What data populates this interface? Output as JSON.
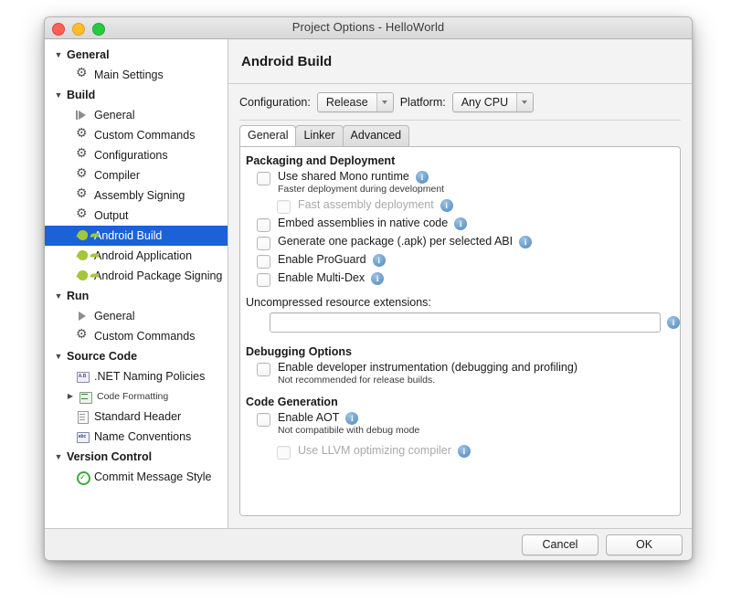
{
  "window": {
    "title": "Project Options - HelloWorld",
    "traffic_lights": [
      "close-red",
      "minimize-yellow",
      "zoom-green"
    ]
  },
  "sidebar": {
    "items": [
      {
        "label": "General",
        "type": "group",
        "icon": "disclosure-down",
        "expanded": true
      },
      {
        "label": "Main Settings",
        "type": "leaf",
        "icon": "gear-icon"
      },
      {
        "label": "Build",
        "type": "group",
        "icon": "disclosure-down",
        "expanded": true
      },
      {
        "label": "General",
        "type": "leaf",
        "icon": "run-icon"
      },
      {
        "label": "Custom Commands",
        "type": "leaf",
        "icon": "gear-icon"
      },
      {
        "label": "Configurations",
        "type": "leaf",
        "icon": "gear-icon"
      },
      {
        "label": "Compiler",
        "type": "leaf",
        "icon": "gear-icon"
      },
      {
        "label": "Assembly Signing",
        "type": "leaf",
        "icon": "gear-icon"
      },
      {
        "label": "Output",
        "type": "leaf",
        "icon": "gear-icon"
      },
      {
        "label": "Android Build",
        "type": "leaf",
        "icon": "android-icon",
        "selected": true
      },
      {
        "label": "Android Application",
        "type": "leaf",
        "icon": "android-icon"
      },
      {
        "label": "Android Package Signing",
        "type": "leaf",
        "icon": "android-icon"
      },
      {
        "label": "Run",
        "type": "group",
        "icon": "disclosure-down",
        "expanded": true
      },
      {
        "label": "General",
        "type": "leaf",
        "icon": "play-icon"
      },
      {
        "label": "Custom Commands",
        "type": "leaf",
        "icon": "gear-icon"
      },
      {
        "label": "Source Code",
        "type": "group",
        "icon": "disclosure-down",
        "expanded": true
      },
      {
        "label": ".NET Naming Policies",
        "type": "leaf",
        "icon": "ab-icon"
      },
      {
        "label": "Code Formatting",
        "type": "leaf-collapsible",
        "icon": "format-icon",
        "expanded": false
      },
      {
        "label": "Standard Header",
        "type": "leaf",
        "icon": "document-icon"
      },
      {
        "label": "Name Conventions",
        "type": "leaf",
        "icon": "name-conventions-icon"
      },
      {
        "label": "Version Control",
        "type": "group",
        "icon": "disclosure-down",
        "expanded": true
      },
      {
        "label": "Commit Message Style",
        "type": "leaf",
        "icon": "check-circle-icon"
      }
    ]
  },
  "pane": {
    "title": "Android Build",
    "configuration_label": "Configuration:",
    "configuration_value": "Release",
    "platform_label": "Platform:",
    "platform_value": "Any CPU",
    "tabs": [
      {
        "label": "General",
        "active": true
      },
      {
        "label": "Linker",
        "active": false
      },
      {
        "label": "Advanced",
        "active": false
      }
    ],
    "sections": {
      "packaging": {
        "heading": "Packaging and Deployment",
        "options": [
          {
            "label": "Use shared Mono runtime",
            "sublabel": "Faster deployment during development",
            "checked": false,
            "disabled": false,
            "info": true,
            "indent": false
          },
          {
            "label": "Fast assembly deployment",
            "sublabel": "",
            "checked": false,
            "disabled": true,
            "info": true,
            "indent": true
          },
          {
            "label": "Embed assemblies in native code",
            "sublabel": "",
            "checked": false,
            "disabled": false,
            "info": true,
            "indent": false
          },
          {
            "label": "Generate one package (.apk) per selected ABI",
            "sublabel": "",
            "checked": false,
            "disabled": false,
            "info": true,
            "indent": false
          },
          {
            "label": "Enable ProGuard",
            "sublabel": "",
            "checked": false,
            "disabled": false,
            "info": true,
            "indent": false
          },
          {
            "label": "Enable Multi-Dex",
            "sublabel": "",
            "checked": false,
            "disabled": false,
            "info": true,
            "indent": false
          }
        ],
        "field_label": "Uncompressed resource extensions:",
        "field_value": "",
        "field_placeholder": ""
      },
      "debugging": {
        "heading": "Debugging Options",
        "options": [
          {
            "label": "Enable developer instrumentation (debugging and profiling)",
            "sublabel": "Not recommended for release builds.",
            "checked": false,
            "disabled": false,
            "info": false,
            "indent": false
          }
        ]
      },
      "codegen": {
        "heading": "Code Generation",
        "options": [
          {
            "label": "Enable AOT",
            "sublabel": "Not compatibile with debug mode",
            "checked": false,
            "disabled": false,
            "info": true,
            "indent": false
          },
          {
            "label": "Use LLVM optimizing compiler",
            "sublabel": "",
            "checked": false,
            "disabled": true,
            "info": true,
            "indent": true
          }
        ]
      }
    }
  },
  "footer": {
    "cancel_label": "Cancel",
    "ok_label": "OK"
  },
  "colors": {
    "selection_blue": "#1a62d6",
    "android_green": "#a4c639",
    "info_blue": "#6d9fcd",
    "window_chrome": "#ececec"
  }
}
